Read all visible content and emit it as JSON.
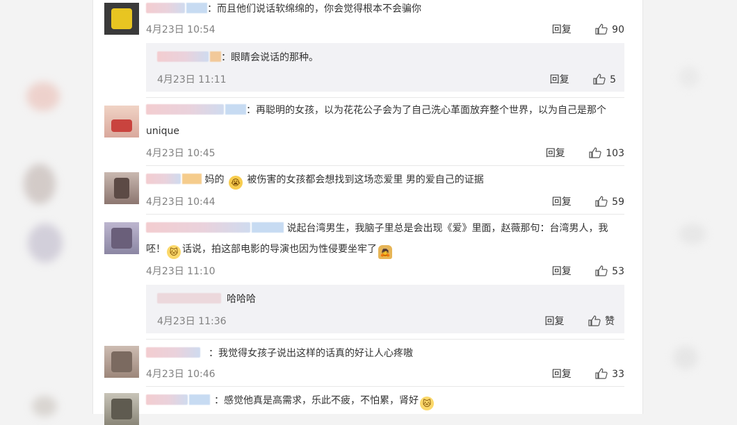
{
  "comments": [
    {
      "text": "：而且他们说话软绵绵的，你会觉得根本不会骗你",
      "date": "4月23日 10:54",
      "reply": "回复",
      "likes": "90"
    },
    {
      "text": "：眼睛会说话的那种。",
      "date": "4月23日 11:11",
      "reply": "回复",
      "likes": "5"
    },
    {
      "text": "：再聪明的女孩，以为花花公子会为了自己洗心革面放弃整个世界，以为自己是那个unique",
      "date": "4月23日 10:45",
      "reply": "回复",
      "likes": "103"
    },
    {
      "text_a": "妈的",
      "text_b": "被伤害的女孩都会想找到这场恋爱里 男的爱自己的证据",
      "date": "4月23日 10:44",
      "reply": "回复",
      "likes": "59"
    },
    {
      "text_a": "说起台湾男生，我脑子里总是会出现《爱》里面，赵薇那句：台湾男人，我呸！",
      "text_b": "话说，拍这部电影的导演也因为性侵要坐牢了",
      "date": "4月23日 11:10",
      "reply": "回复",
      "likes": "53"
    },
    {
      "text": "哈哈哈",
      "date": "4月23日 11:36",
      "reply": "回复",
      "likes": "赞"
    },
    {
      "text": "：我觉得女孩子说出这样的话真的好让人心疼嗷",
      "date": "4月23日 10:46",
      "reply": "回复",
      "likes": "33"
    },
    {
      "text": "：感觉他真是高需求，乐此不疲，不怕累，肾好"
    }
  ],
  "icons": {
    "like": "thumbs-up-icon"
  },
  "colors": {
    "date": "#808080",
    "reply_bg": "#f2f2f5",
    "panel": "#ffffff"
  }
}
